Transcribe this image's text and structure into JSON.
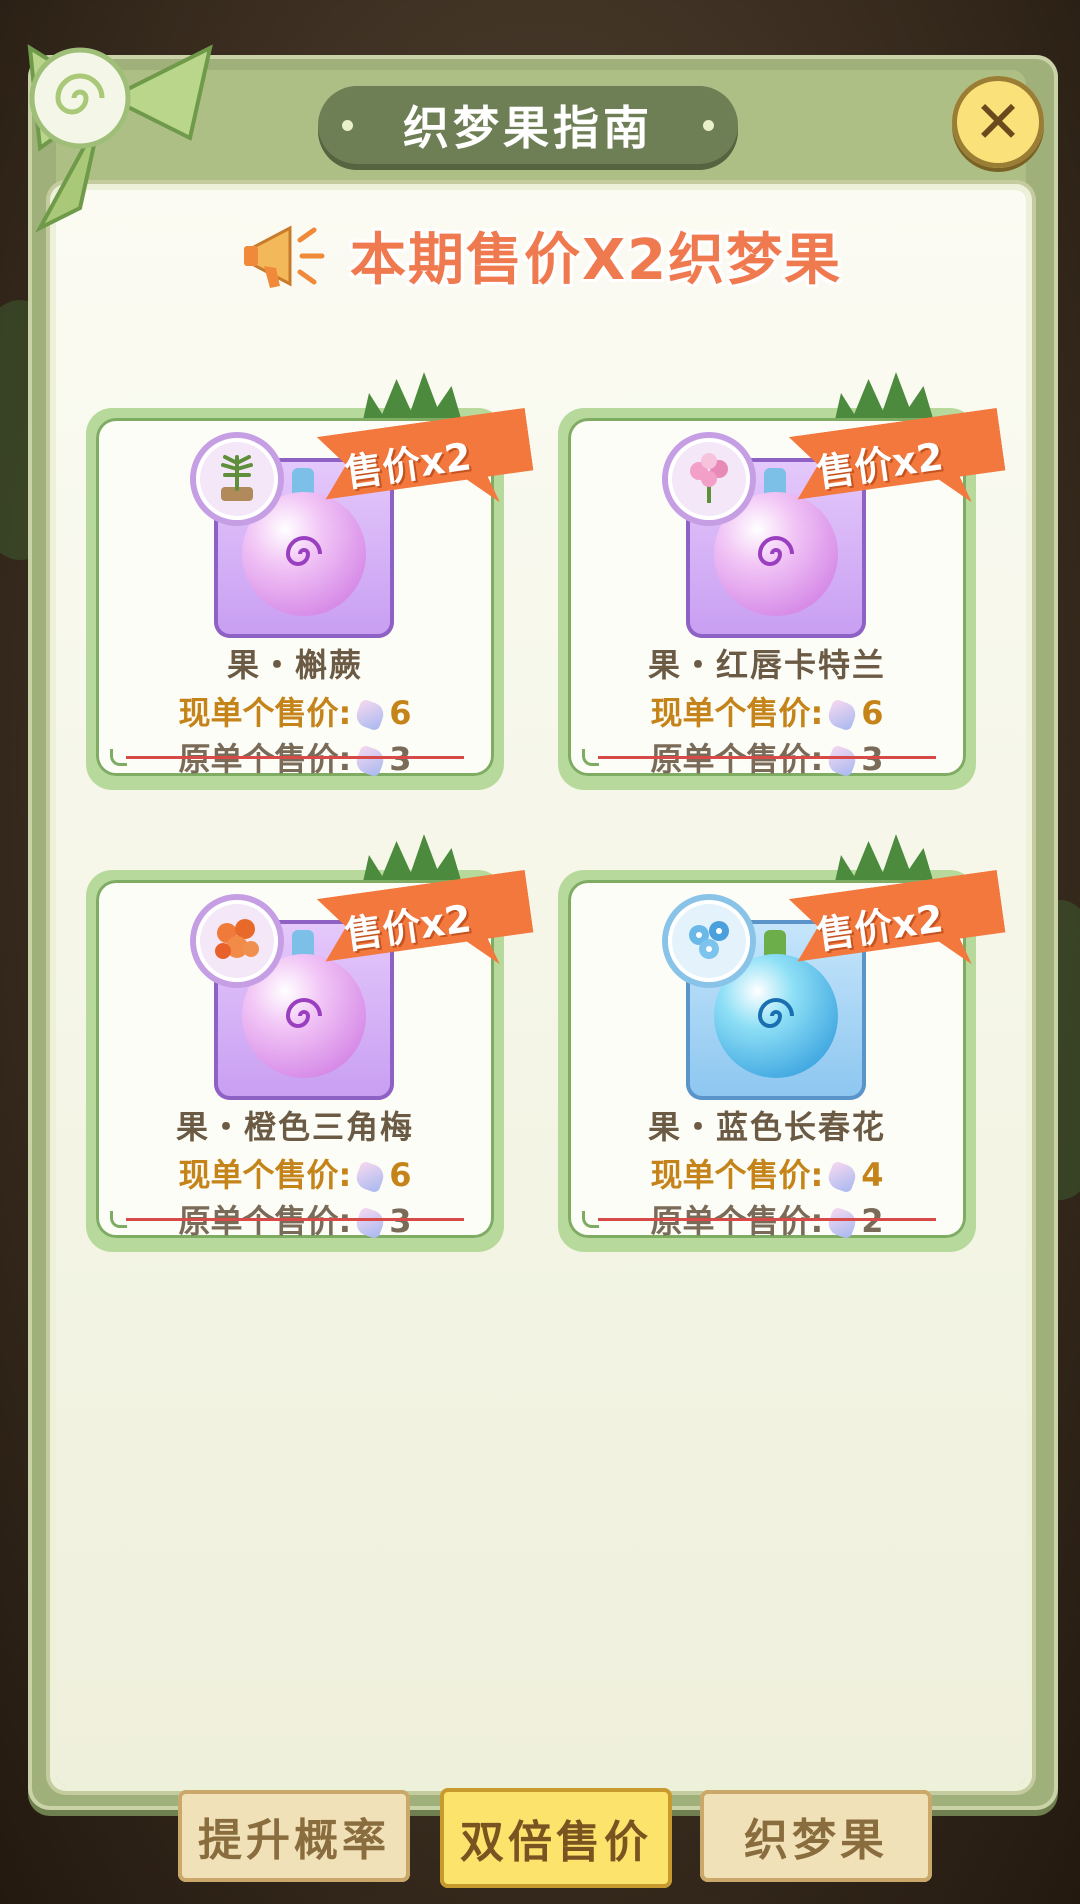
{
  "header": {
    "title": "织梦果指南",
    "close_label": "✕"
  },
  "announcement": {
    "text": "本期售价X2织梦果"
  },
  "cards": [
    {
      "badge": "售价x2",
      "name": "果・槲蕨",
      "now_label": "现单个售价:",
      "now_value": "6",
      "orig_label": "原单个售价:",
      "orig_value": "3",
      "theme": "purple"
    },
    {
      "badge": "售价x2",
      "name": "果・红唇卡特兰",
      "now_label": "现单个售价:",
      "now_value": "6",
      "orig_label": "原单个售价:",
      "orig_value": "3",
      "theme": "purple"
    },
    {
      "badge": "售价x2",
      "name": "果・橙色三角梅",
      "now_label": "现单个售价:",
      "now_value": "6",
      "orig_label": "原单个售价:",
      "orig_value": "3",
      "theme": "purple"
    },
    {
      "badge": "售价x2",
      "name": "果・蓝色长春花",
      "now_label": "现单个售价:",
      "now_value": "4",
      "orig_label": "原单个售价:",
      "orig_value": "2",
      "theme": "blue"
    }
  ],
  "tabs": [
    {
      "label": "提升概率",
      "active": false
    },
    {
      "label": "双倍售价",
      "active": true
    },
    {
      "label": "织梦果",
      "active": false
    }
  ],
  "colors": {
    "accent_orange": "#f2783e",
    "price_gold": "#c5841a",
    "panel_green": "#9fb07a",
    "strike_red": "#d84a48"
  }
}
